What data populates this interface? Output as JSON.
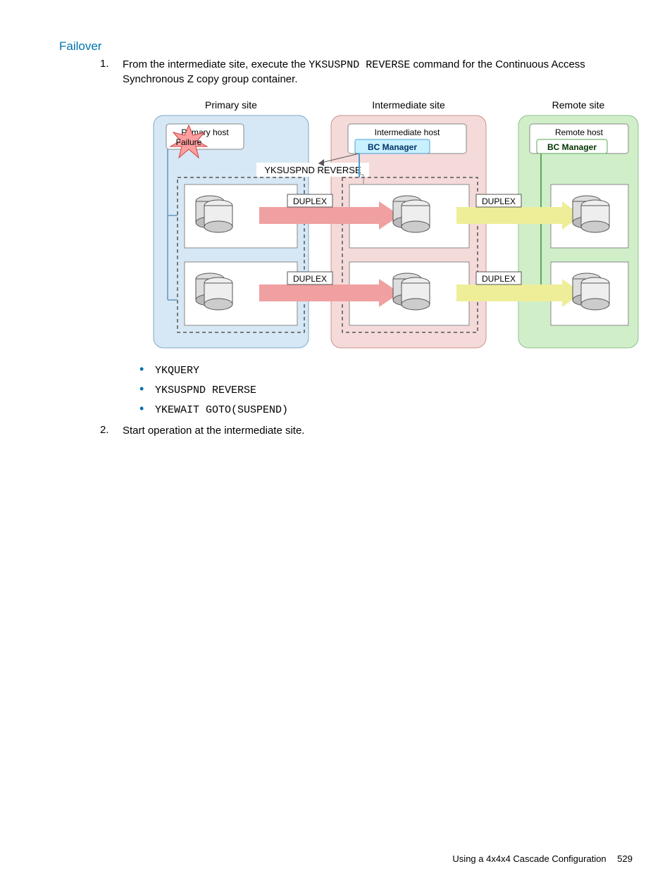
{
  "heading": "Failover",
  "steps": [
    {
      "num": "1.",
      "text_pre": "From the intermediate site, execute the ",
      "cmd": "YKSUSPND REVERSE",
      "text_post": " command for the Continuous Access Synchronous Z copy group container."
    },
    {
      "num": "2.",
      "text_pre": "Start operation at the intermediate site.",
      "cmd": "",
      "text_post": ""
    }
  ],
  "bullets": [
    "YKQUERY",
    "YKSUSPND REVERSE",
    "YKEWAIT GOTO(SUSPEND)"
  ],
  "diagram": {
    "primary_site": "Primary site",
    "intermediate_site": "Intermediate site",
    "remote_site": "Remote site",
    "primary_host": "Primary host",
    "intermediate_host": "Intermediate host",
    "remote_host": "Remote host",
    "bc_manager": "BC Manager",
    "failure": "Failure",
    "yksuspnd": "YKSUSPND REVERSE",
    "duplex": "DUPLEX"
  },
  "footer": {
    "label": "Using a 4x4x4 Cascade Configuration",
    "page": "529"
  }
}
